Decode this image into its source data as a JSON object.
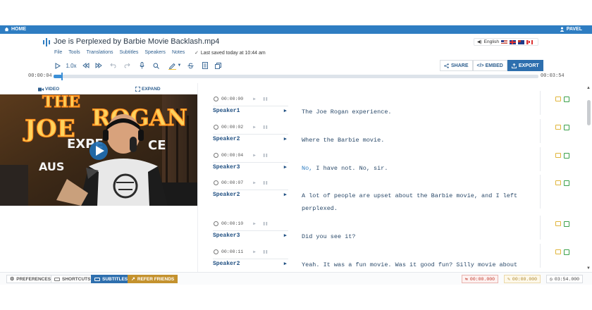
{
  "topbar": {
    "home_label": "HOME",
    "user_label": "PAVEL"
  },
  "header": {
    "file_title": "Joe is Perplexed by Barbie Movie Backlash.mp4",
    "menu": [
      "File",
      "Tools",
      "Translations",
      "Subtitles",
      "Speakers",
      "Notes"
    ],
    "saved_status": "Last saved today at 10:44 am",
    "language": {
      "label": "English"
    }
  },
  "toolbar": {
    "speed": "1.0x"
  },
  "actions": {
    "share": "SHARE",
    "embed": "</> EMBED",
    "export": "EXPORT"
  },
  "timeline": {
    "current": "00:00:04",
    "total": "00:03:54",
    "progress": 0.018
  },
  "video_panel": {
    "video_tab": "VIDEO",
    "expand_label": "EXPAND"
  },
  "transcript": [
    {
      "time": "00:00:00",
      "speaker": "Speaker1",
      "lines": [
        "The Joe Rogan experience."
      ]
    },
    {
      "time": "00:00:02",
      "speaker": "Speaker2",
      "lines": [
        "Where the Barbie movie."
      ]
    },
    {
      "time": "00:00:04",
      "speaker": "Speaker3",
      "lines": [
        "No, I have not. No, sir."
      ]
    },
    {
      "time": "00:00:07",
      "speaker": "Speaker2",
      "lines": [
        "A lot of people are upset about the Barbie movie, and I left",
        "perplexed."
      ]
    },
    {
      "time": "00:00:10",
      "speaker": "Speaker3",
      "lines": [
        "Did you see it?"
      ]
    },
    {
      "time": "00:00:11",
      "speaker": "Speaker2",
      "lines": [
        "Yeah. It was a fun movie. Was it good fun? Silly movie about dolls"
      ]
    }
  ],
  "footer": {
    "preferences": "PREFERENCES",
    "shortcuts": "SHORTCUTS",
    "subtitles": "SUBTITLES",
    "refer": "REFER FRIENDS",
    "stat_sync": "00:00.000",
    "stat_edit": "00:00.000",
    "stat_duration": "03:54.000"
  },
  "colors": {
    "brand": "#2e7dc2",
    "accent_export": "#2e6fae",
    "refer": "#c4922e",
    "speaker": "#1f4f82"
  }
}
